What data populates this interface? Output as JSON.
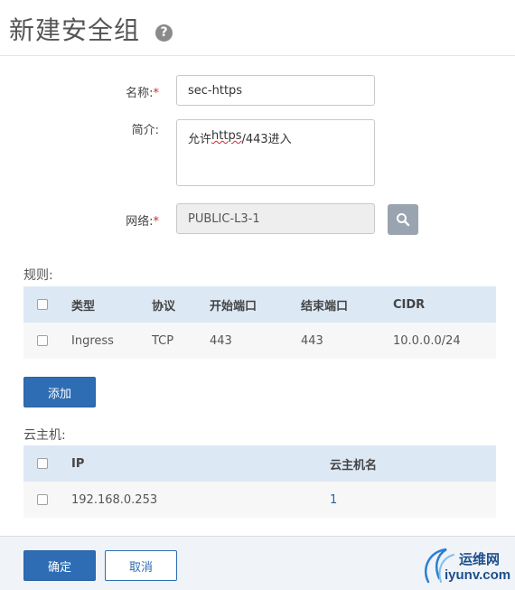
{
  "header": {
    "title": "新建安全组",
    "help_icon": "?"
  },
  "form": {
    "name_label": "名称:",
    "name_required": "*",
    "name_value": "sec-https",
    "desc_label": "简介:",
    "desc_value_prefix": "允许",
    "desc_value_underlined": "https",
    "desc_value_suffix": "/443进入",
    "network_label": "网络:",
    "network_required": "*",
    "network_value": "PUBLIC-L3-1",
    "search_icon": "search-icon"
  },
  "rules": {
    "section_label": "规则:",
    "columns": [
      "类型",
      "协议",
      "开始端口",
      "结束端口",
      "CIDR"
    ],
    "rows": [
      {
        "type": "Ingress",
        "protocol": "TCP",
        "start_port": "443",
        "end_port": "443",
        "cidr": "10.0.0.0/24"
      }
    ],
    "add_button": "添加"
  },
  "vms": {
    "section_label": "云主机:",
    "columns": [
      "IP",
      "云主机名"
    ],
    "rows": [
      {
        "ip": "192.168.0.253",
        "name": "1"
      }
    ]
  },
  "footer": {
    "confirm_button": "确定",
    "cancel_button": "取消"
  },
  "watermark": {
    "line1": "运维网",
    "line2": "iyunv.com"
  },
  "colors": {
    "primary": "#2e6db3",
    "table_header": "#dde8f5",
    "required": "#d9262c",
    "disabled_bg": "#eeeeee"
  }
}
